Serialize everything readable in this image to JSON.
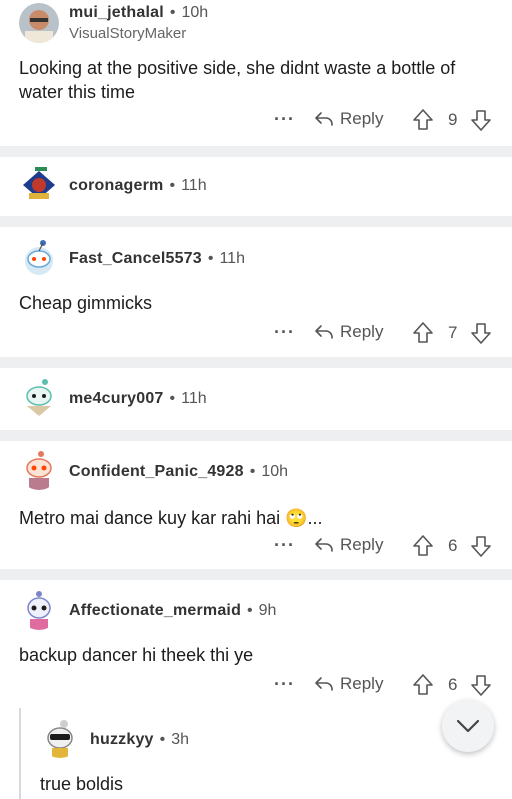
{
  "comments": [
    {
      "user": "mui_jethalal",
      "time": "10h",
      "flair": "VisualStoryMaker",
      "body": "Looking at the positive side, she didnt waste a bottle of water this time",
      "reply": "Reply",
      "score": "9"
    },
    {
      "user": "coronagerm",
      "time": "11h"
    },
    {
      "user": "Fast_Cancel5573",
      "time": "11h",
      "body": "Cheap gimmicks",
      "reply": "Reply",
      "score": "7"
    },
    {
      "user": "me4cury007",
      "time": "11h"
    },
    {
      "user": "Confident_Panic_4928",
      "time": "10h",
      "body": "Metro mai dance kuy kar rahi hai 🙄...",
      "reply": "Reply",
      "score": "6"
    },
    {
      "user": "Affectionate_mermaid",
      "time": "9h",
      "body": "backup dancer hi theek thi ye",
      "reply": "Reply",
      "score": "6"
    },
    {
      "user": "huzzkyy",
      "time": "3h",
      "body": "true boldis"
    }
  ],
  "icons": {
    "more": "more-icon",
    "reply": "reply-arrow-icon",
    "upvote": "upvote-icon",
    "downvote": "downvote-icon",
    "scroll": "chevron-down-icon"
  },
  "separator_dot": "•",
  "more_glyph": "···"
}
